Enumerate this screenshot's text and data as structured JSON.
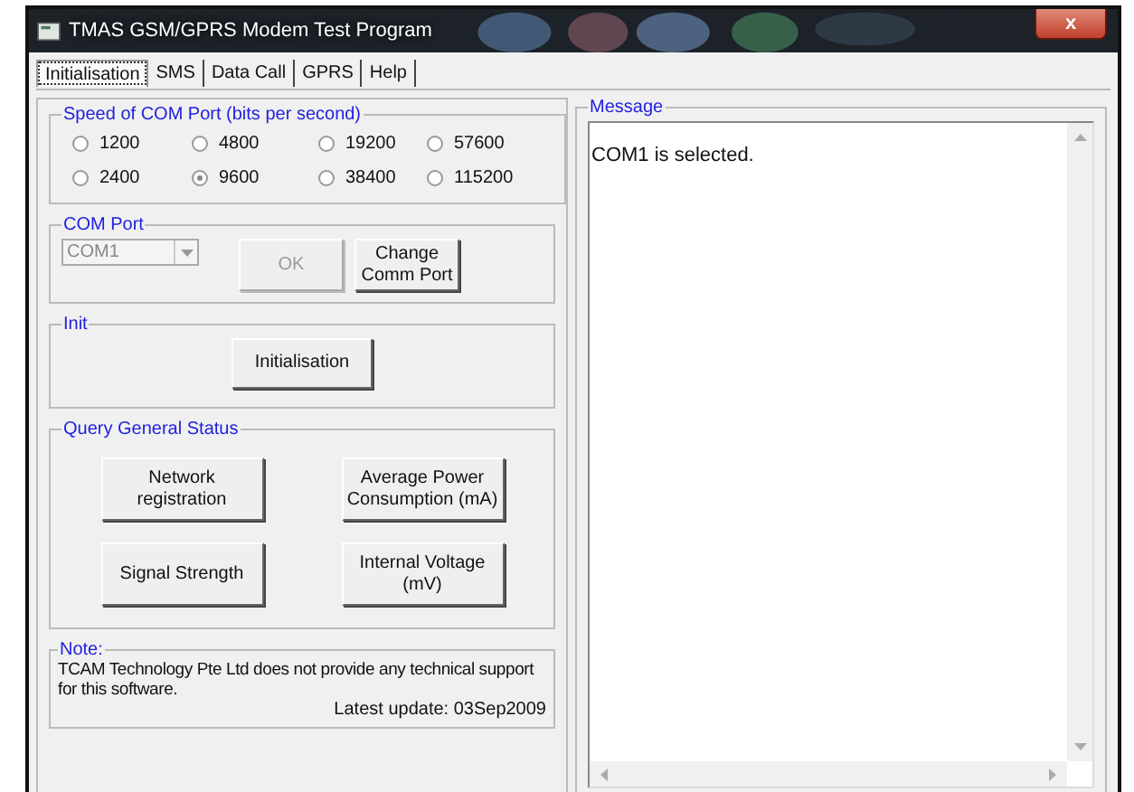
{
  "window": {
    "title": "TMAS GSM/GPRS Modem Test Program",
    "close": "x"
  },
  "tabs": [
    {
      "label": "Initialisation",
      "selected": true
    },
    {
      "label": "SMS",
      "selected": false
    },
    {
      "label": "Data Call",
      "selected": false
    },
    {
      "label": "GPRS",
      "selected": false
    },
    {
      "label": "Help",
      "selected": false
    }
  ],
  "speed_group": {
    "title": "Speed of COM Port (bits per second)",
    "options": [
      {
        "label": "1200",
        "selected": false
      },
      {
        "label": "4800",
        "selected": false
      },
      {
        "label": "19200",
        "selected": false
      },
      {
        "label": "57600",
        "selected": false
      },
      {
        "label": "2400",
        "selected": false
      },
      {
        "label": "9600",
        "selected": true
      },
      {
        "label": "38400",
        "selected": false
      },
      {
        "label": "115200",
        "selected": false
      }
    ]
  },
  "com_port_group": {
    "title": "COM Port",
    "port": {
      "value": "COM1",
      "disabled": true
    },
    "buttons": [
      {
        "label": "OK",
        "disabled": true
      },
      {
        "label": "Change\nComm Port",
        "disabled": false
      }
    ]
  },
  "init_group": {
    "title": "Init",
    "button": "Initialisation"
  },
  "query_group": {
    "title": "Query General Status",
    "buttons": [
      "Network\nregistration",
      "Average Power\nConsumption (mA)",
      "Signal Strength",
      "Internal Voltage\n(mV)"
    ]
  },
  "note_group": {
    "title": "Note:",
    "text": "TCAM Technology Pte Ltd does not provide any technical support for this software.",
    "update": "Latest update: 03Sep2009"
  },
  "message_group": {
    "title": "Message",
    "lines": [
      "COM1 is selected."
    ]
  }
}
